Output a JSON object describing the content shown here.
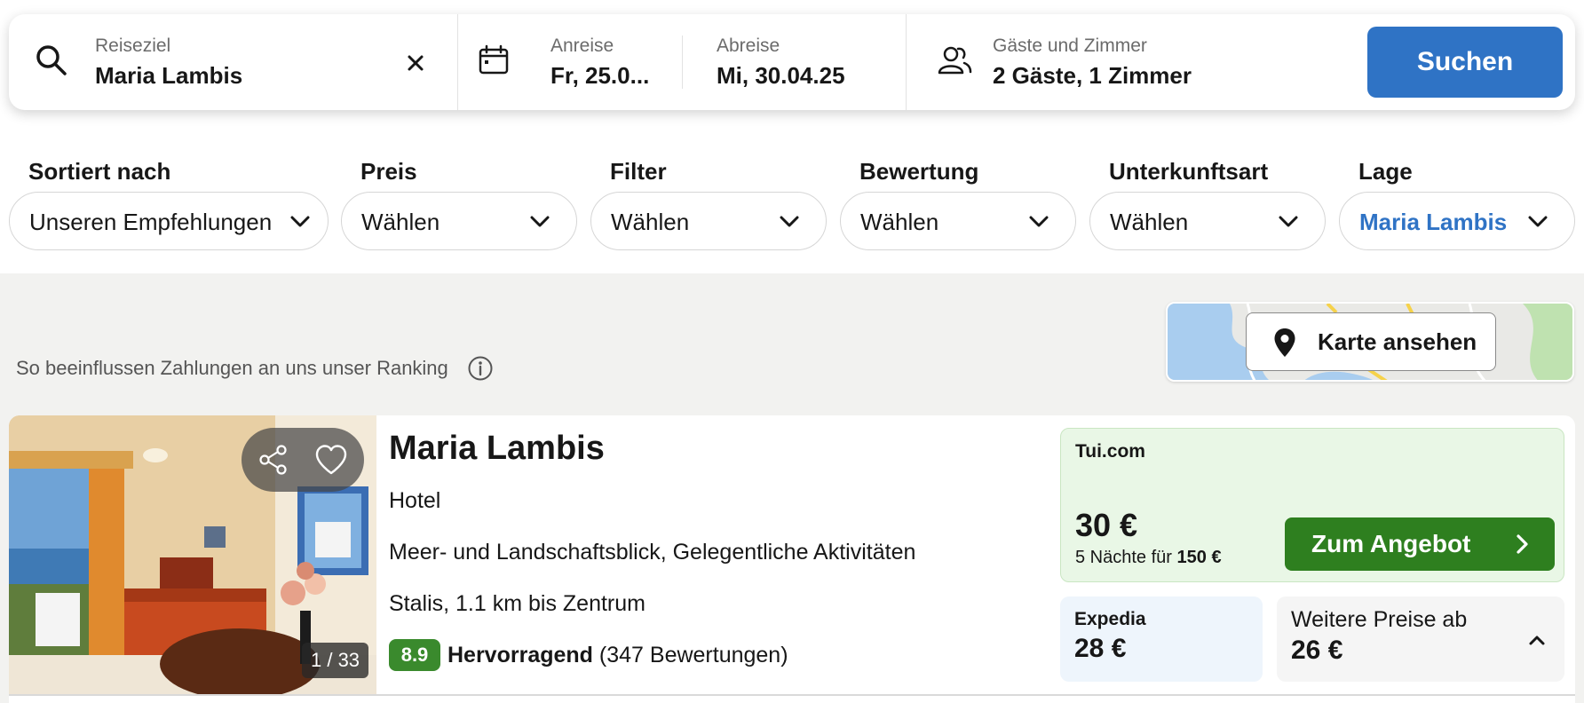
{
  "search": {
    "destination": {
      "label": "Reiseziel",
      "value": "Maria Lambis"
    },
    "checkin": {
      "label": "Anreise",
      "value": "Fr, 25.0..."
    },
    "checkout": {
      "label": "Abreise",
      "value": "Mi, 30.04.25"
    },
    "guests": {
      "label": "Gäste und Zimmer",
      "value": "2 Gäste, 1 Zimmer"
    },
    "button_label": "Suchen",
    "accent_color": "#2f73c5"
  },
  "filters": [
    {
      "label": "Sortiert nach",
      "value": "Unseren Empfehlungen"
    },
    {
      "label": "Preis",
      "value": "Wählen"
    },
    {
      "label": "Filter",
      "value": "Wählen"
    },
    {
      "label": "Bewertung",
      "value": "Wählen"
    },
    {
      "label": "Unterkunftsart",
      "value": "Wählen"
    },
    {
      "label": "Lage",
      "value": "Maria Lambis"
    }
  ],
  "ranking_note": "So beeinflussen Zahlungen an uns unser Ranking",
  "map": {
    "button_label": "Karte ansehen"
  },
  "listing": {
    "name": "Maria Lambis",
    "type": "Hotel",
    "features": "Meer- und Landschaftsblick, Gelegentliche Aktivitäten",
    "location": "Stalis, 1.1 km bis Zentrum",
    "photo_counter": "1 / 33",
    "rating": {
      "score": "8.9",
      "word": "Hervorragend",
      "reviews": "(347 Bewertungen)",
      "color": "#3a8a2d"
    },
    "main_offer": {
      "provider": "Tui.com",
      "price": "30 €",
      "nights_text": "5 Nächte für",
      "total": "150 €",
      "button_label": "Zum Angebot",
      "button_color": "#2e7f1f"
    },
    "alt_offer": {
      "provider": "Expedia",
      "price": "28 €"
    },
    "more_prices": {
      "label": "Weitere Preise ab",
      "price": "26 €"
    }
  }
}
